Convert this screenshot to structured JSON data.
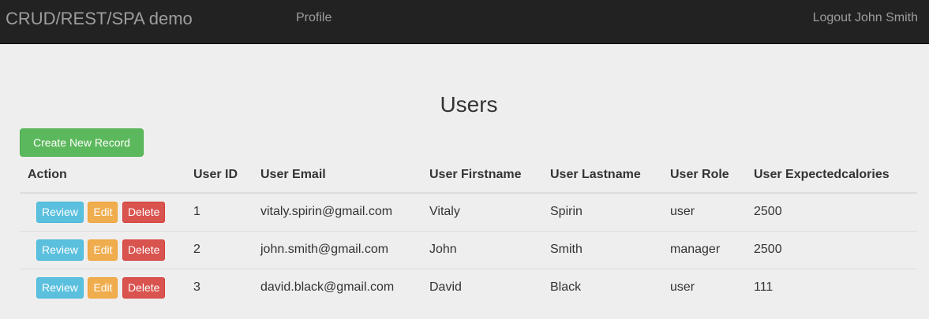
{
  "nav": {
    "brand": "CRUD/REST/SPA demo",
    "profile": "Profile",
    "logout": "Logout John Smith"
  },
  "page": {
    "title": "Users",
    "create_label": "Create New Record"
  },
  "table": {
    "headers": [
      "Action",
      "User ID",
      "User Email",
      "User Firstname",
      "User Lastname",
      "User Role",
      "User Expectedcalories"
    ],
    "actions": {
      "review": "Review",
      "edit": "Edit",
      "delete": "Delete"
    },
    "rows": [
      {
        "id": "1",
        "email": "vitaly.spirin@gmail.com",
        "first": "Vitaly",
        "last": "Spirin",
        "role": "user",
        "calories": "2500"
      },
      {
        "id": "2",
        "email": "john.smith@gmail.com",
        "first": "John",
        "last": "Smith",
        "role": "manager",
        "calories": "2500"
      },
      {
        "id": "3",
        "email": "david.black@gmail.com",
        "first": "David",
        "last": "Black",
        "role": "user",
        "calories": "111"
      }
    ]
  }
}
